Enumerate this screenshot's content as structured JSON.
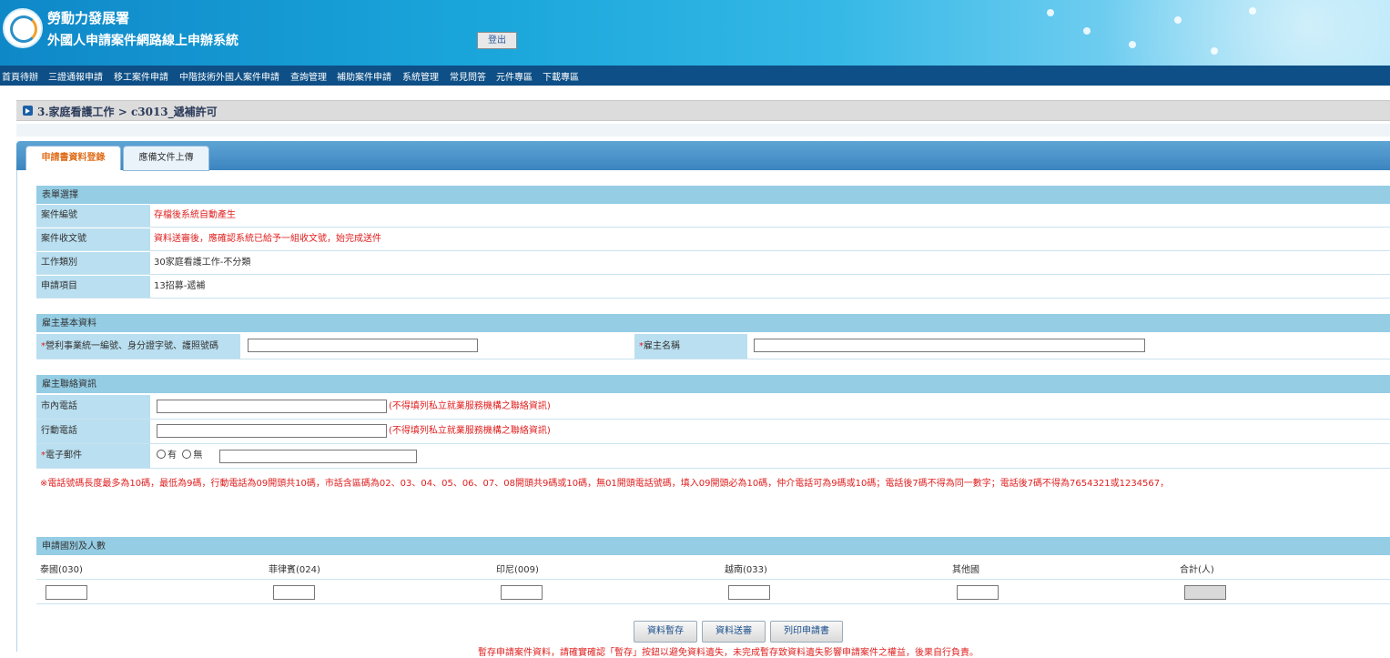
{
  "header": {
    "org_name": "勞動力發展署",
    "system_name": "外國人申請案件網路線上申辦系統",
    "logout_label": "登出"
  },
  "nav": [
    "首頁待辦",
    "三證通報申請",
    "移工案件申請",
    "中階技術外國人案件申請",
    "查詢管理",
    "補助案件申請",
    "系統管理",
    "常見問答",
    "元件專區",
    "下載專區"
  ],
  "breadcrumb": "3.家庭看護工作 > c3013_遞補許可",
  "tabs": {
    "active": "申請書資料登錄",
    "inactive": "應備文件上傳"
  },
  "form_select": {
    "title": "表單選擇",
    "rows": [
      {
        "label": "案件編號",
        "value": "存檔後系統自動產生"
      },
      {
        "label": "案件收文號",
        "value": "資料送審後，應確認系統已給予一組收文號，始完成送件"
      },
      {
        "label": "工作類別",
        "value": "30家庭看護工作-不分類"
      },
      {
        "label": "申請項目",
        "value": "13招募-遞補"
      }
    ]
  },
  "employer": {
    "title": "雇主基本資料",
    "id_label": "營利事業統一編號、身分證字號、護照號碼",
    "name_label": "雇主名稱",
    "required_mark": "*"
  },
  "contact": {
    "title": "雇主聯絡資訊",
    "phone_label": "市內電話",
    "mobile_label": "行動電話",
    "email_label": "電子郵件",
    "phone_hint": "(不得填列私立就業服務機構之聯絡資訊)",
    "mobile_hint": "(不得填列私立就業服務機構之聯絡資訊)",
    "radio_yes": "有",
    "radio_no": "無",
    "note": "※電話號碼長度最多為10碼，最低為9碼，行動電話為09開頭共10碼，市話含區碼為02、03、04、05、06、07、08開頭共9碼或10碼，無01開頭電話號碼，填入09開頭必為10碼，仲介電話可為9碼或10碼；電話後7碼不得為同一數字；電話後7碼不得為7654321或1234567，"
  },
  "nationality": {
    "title": "申請國別及人數",
    "columns": [
      "泰國(030)",
      "菲律賓(024)",
      "印尼(009)",
      "越南(033)",
      "其他國",
      "合計(人)"
    ]
  },
  "buttons": {
    "save": "資料暫存",
    "submit": "資料送審",
    "print": "列印申請書"
  },
  "warning": "暫存申請案件資料，請確實確認「暫存」按鈕以避免資料遺失，未完成暫存致資料遺失影響申請案件之權益，後果自行負責。"
}
